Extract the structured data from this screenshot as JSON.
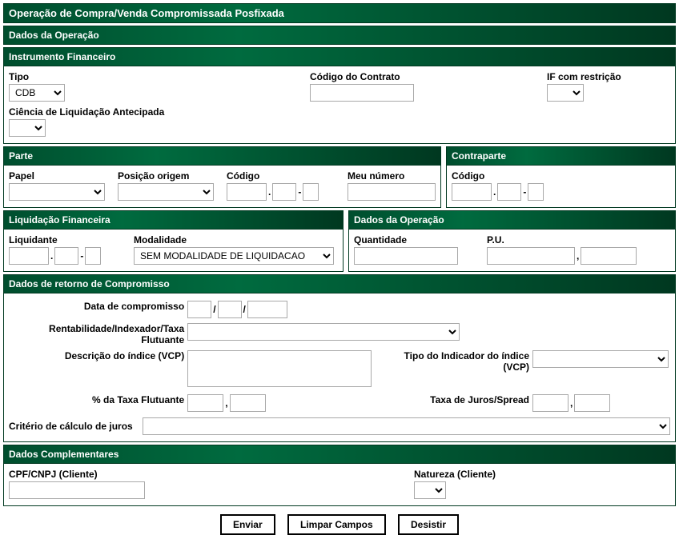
{
  "title": "Operação de Compra/Venda Compromissada Posfixada",
  "sections": {
    "dados_operacao_top": "Dados da Operação",
    "instrumento": "Instrumento Financeiro",
    "parte": "Parte",
    "contraparte": "Contraparte",
    "liquidacao": "Liquidação Financeira",
    "dados_operacao_mid": "Dados da Operação",
    "retorno": "Dados de retorno de Compromisso",
    "complementares": "Dados Complementares"
  },
  "instrumento": {
    "tipo_label": "Tipo",
    "tipo_value": "CDB",
    "codigo_contrato_label": "Código do Contrato",
    "codigo_contrato_value": "",
    "if_restricao_label": "IF com restrição",
    "if_restricao_value": "",
    "ciencia_label": "Ciência de Liquidação Antecipada",
    "ciencia_value": ""
  },
  "parte": {
    "papel_label": "Papel",
    "papel_value": "",
    "posicao_label": "Posição origem",
    "posicao_value": "",
    "codigo_label": "Código",
    "codigo_a": "",
    "codigo_b": "",
    "codigo_c": "",
    "meu_numero_label": "Meu número",
    "meu_numero_value": ""
  },
  "contraparte": {
    "codigo_label": "Código",
    "codigo_a": "",
    "codigo_b": "",
    "codigo_c": ""
  },
  "liquidacao": {
    "liquidante_label": "Liquidante",
    "liquidante_a": "",
    "liquidante_b": "",
    "liquidante_c": "",
    "modalidade_label": "Modalidade",
    "modalidade_value": "SEM MODALIDADE DE LIQUIDACAO"
  },
  "dados_op": {
    "quantidade_label": "Quantidade",
    "quantidade_value": "",
    "pu_label": "P.U.",
    "pu_int": "",
    "pu_dec": ""
  },
  "retorno": {
    "data_label": "Data de compromisso",
    "data_d": "",
    "data_m": "",
    "data_y": "",
    "rentab_label": "Rentabilidade/Indexador/Taxa Flutuante",
    "rentab_value": "",
    "desc_indice_label": "Descrição do índice (VCP)",
    "desc_indice_value": "",
    "tipo_indicador_label": "Tipo do Indicador do índice (VCP)",
    "tipo_indicador_value": "",
    "pct_taxa_label": "% da Taxa Flutuante",
    "pct_taxa_int": "",
    "pct_taxa_dec": "",
    "taxa_juros_label": "Taxa de Juros/Spread",
    "taxa_juros_int": "",
    "taxa_juros_dec": "",
    "criterio_label": "Critério de cálculo de juros",
    "criterio_value": ""
  },
  "complementares": {
    "cpf_label": "CPF/CNPJ (Cliente)",
    "cpf_value": "",
    "natureza_label": "Natureza (Cliente)",
    "natureza_value": ""
  },
  "buttons": {
    "enviar": "Enviar",
    "limpar": "Limpar Campos",
    "desistir": "Desistir"
  },
  "sep": {
    "slash": "/",
    "dot": ".",
    "dash": "-",
    "comma": ","
  }
}
